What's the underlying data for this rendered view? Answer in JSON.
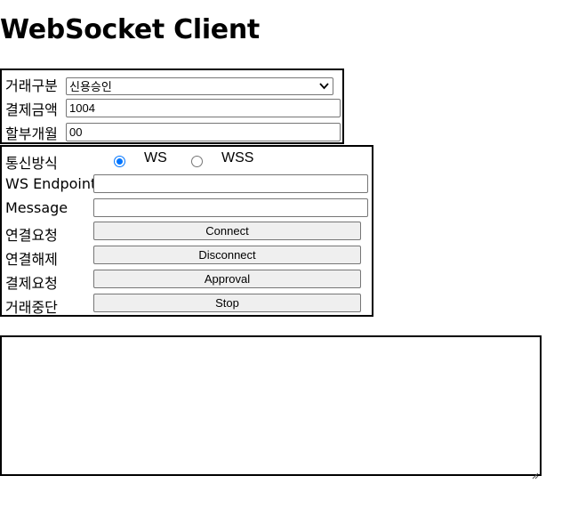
{
  "page": {
    "title": "WebSocket Client"
  },
  "tx": {
    "type_label": "거래구분",
    "type_value": "신용승인",
    "amount_label": "결제금액",
    "amount_value": "1004",
    "installment_label": "할부개월",
    "installment_value": "00"
  },
  "conn": {
    "protocol_label": "통신방식",
    "protocol_options": [
      "WS",
      "WSS"
    ],
    "protocol_selected": "WS",
    "endpoint_label": "WS Endpoint",
    "endpoint_value": "",
    "message_label": "Message",
    "message_value": "",
    "connect_label": "연결요청",
    "connect_button": "Connect",
    "disconnect_label": "연결해제",
    "disconnect_button": "Disconnect",
    "approval_label": "결제요청",
    "approval_button": "Approval",
    "stop_label": "거래중단",
    "stop_button": "Stop"
  },
  "log": {
    "value": ""
  }
}
